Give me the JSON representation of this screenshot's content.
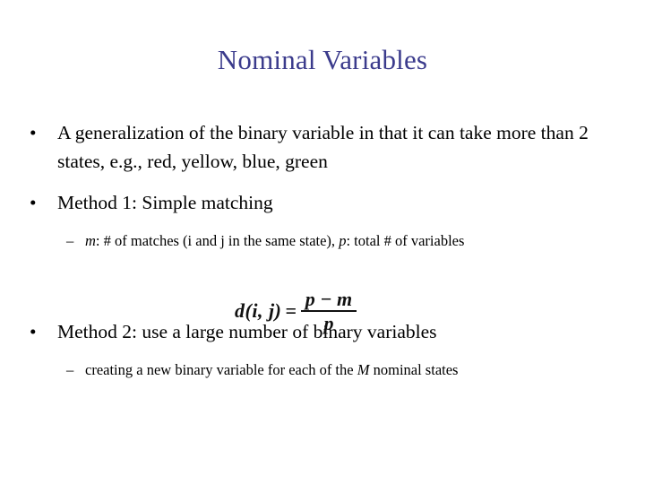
{
  "slide": {
    "title": "Nominal Variables",
    "title_color": "#3b3b8c",
    "background_color": "#ffffff",
    "body_color": "#000000",
    "bullet_marker_level1": "•",
    "bullet_marker_level2": "–",
    "content": [
      {
        "level": 1,
        "id": "bullet-generalization",
        "text": "A generalization of the binary variable in that it can take more than 2 states, e.g., red, yellow, blue, green"
      },
      {
        "level": 1,
        "id": "bullet-method-1",
        "text": "Method 1: Simple matching"
      },
      {
        "level": 2,
        "id": "subbullet-m-p-definition",
        "segments": [
          {
            "text": "m",
            "style": "italic"
          },
          {
            "text": ": # of matches (i and j in the same state),  ",
            "style": "normal"
          },
          {
            "text": "p",
            "style": "italic"
          },
          {
            "text": ": total # of variables",
            "style": "normal"
          }
        ],
        "plain_text": "m: # of matches (i and j in the same state),  p: total # of variables"
      },
      {
        "level": 1,
        "id": "bullet-method-2",
        "text": "Method 2: use a large number of binary variables"
      },
      {
        "level": 2,
        "id": "subbullet-new-binary-variable",
        "segments": [
          {
            "text": "creating a new binary variable for each of the ",
            "style": "normal"
          },
          {
            "text": "M",
            "style": "italic"
          },
          {
            "text": " nominal states",
            "style": "normal"
          }
        ],
        "plain_text": "creating a new binary variable for each of the M nominal states"
      }
    ],
    "equation": {
      "id": "simple-matching-distance-formula",
      "lhs": "d(i, j)",
      "operator": "=",
      "numerator": "p − m",
      "denominator": "p",
      "plain_text": "d(i, j) = (p − m) / p"
    }
  }
}
